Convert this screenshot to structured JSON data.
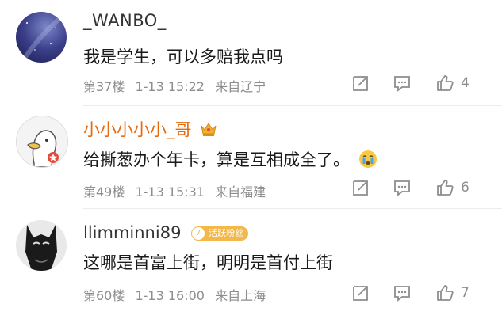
{
  "comments": [
    {
      "username": "_WANBO_",
      "text": "我是学生，可以多赔我点吗",
      "floor": "第37楼",
      "date": "1-13 15:22",
      "location": "来自辽宁",
      "likes": "4",
      "avatar_icon": "night-sky-avatar"
    },
    {
      "username": "小小小小小_哥",
      "text": "给撕葱办个年卡，算是互相成全了。",
      "floor": "第49楼",
      "date": "1-13 15:31",
      "location": "来自福建",
      "likes": "6",
      "avatar_icon": "duck-avatar",
      "name_color": "#e56a11",
      "badge_icon": "crown-icon",
      "emoji_icon": "crying-face-emoji"
    },
    {
      "username": "llimminni89",
      "text": "这哪是首富上街，明明是首付上街",
      "floor": "第60楼",
      "date": "1-13 16:00",
      "location": "来自上海",
      "likes": "7",
      "avatar_icon": "batman-avatar",
      "fan_badge": {
        "level": "7",
        "label": "活跃粉丝"
      }
    }
  ],
  "colors": {
    "meta": "#8d8d8d",
    "highlight_name": "#e56a11",
    "badge": "#f2b84a"
  }
}
